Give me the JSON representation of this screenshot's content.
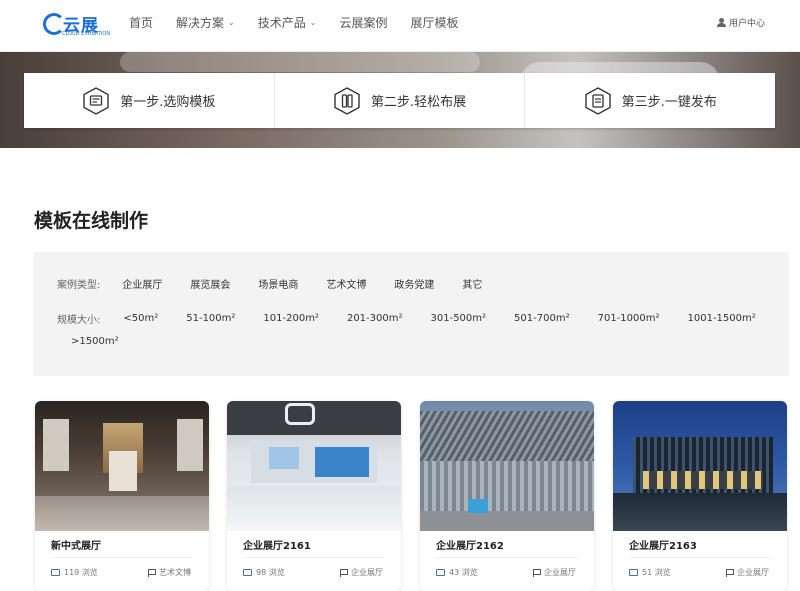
{
  "header": {
    "logo_text": "云展",
    "logo_sub": "CLOUD EXHIBITION",
    "nav": [
      {
        "label": "首页",
        "dropdown": false
      },
      {
        "label": "解决方案",
        "dropdown": true
      },
      {
        "label": "技术产品",
        "dropdown": true
      },
      {
        "label": "云展案例",
        "dropdown": false
      },
      {
        "label": "展厅模板",
        "dropdown": false
      }
    ],
    "user_label": "用户中心"
  },
  "steps": [
    {
      "label": "第一步.选购模板",
      "icon": "template-icon"
    },
    {
      "label": "第二步.轻松布展",
      "icon": "layout-icon"
    },
    {
      "label": "第三步.一键发布",
      "icon": "publish-icon"
    }
  ],
  "section_title": "模板在线制作",
  "filters": {
    "type_label": "案例类型:",
    "types": [
      "企业展厅",
      "展览展会",
      "场景电商",
      "艺术文博",
      "政务党建",
      "其它"
    ],
    "size_label": "规模大小:",
    "sizes": [
      "<50m²",
      "51-100m²",
      "101-200m²",
      "201-300m²",
      "301-500m²",
      "501-700m²",
      "701-1000m²",
      "1001-1500m²"
    ],
    "size_extra": ">1500m²"
  },
  "cards": [
    {
      "title": "新中式展厅",
      "views": "119 浏览",
      "category": "艺术文博"
    },
    {
      "title": "企业展厅2161",
      "views": "98 浏览",
      "category": "企业展厅"
    },
    {
      "title": "企业展厅2162",
      "views": "43 浏览",
      "category": "企业展厅"
    },
    {
      "title": "企业展厅2163",
      "views": "51 浏览",
      "category": "企业展厅"
    }
  ],
  "colors": {
    "brand": "#1a6fd8",
    "filter_bg": "#f3f3f3"
  }
}
